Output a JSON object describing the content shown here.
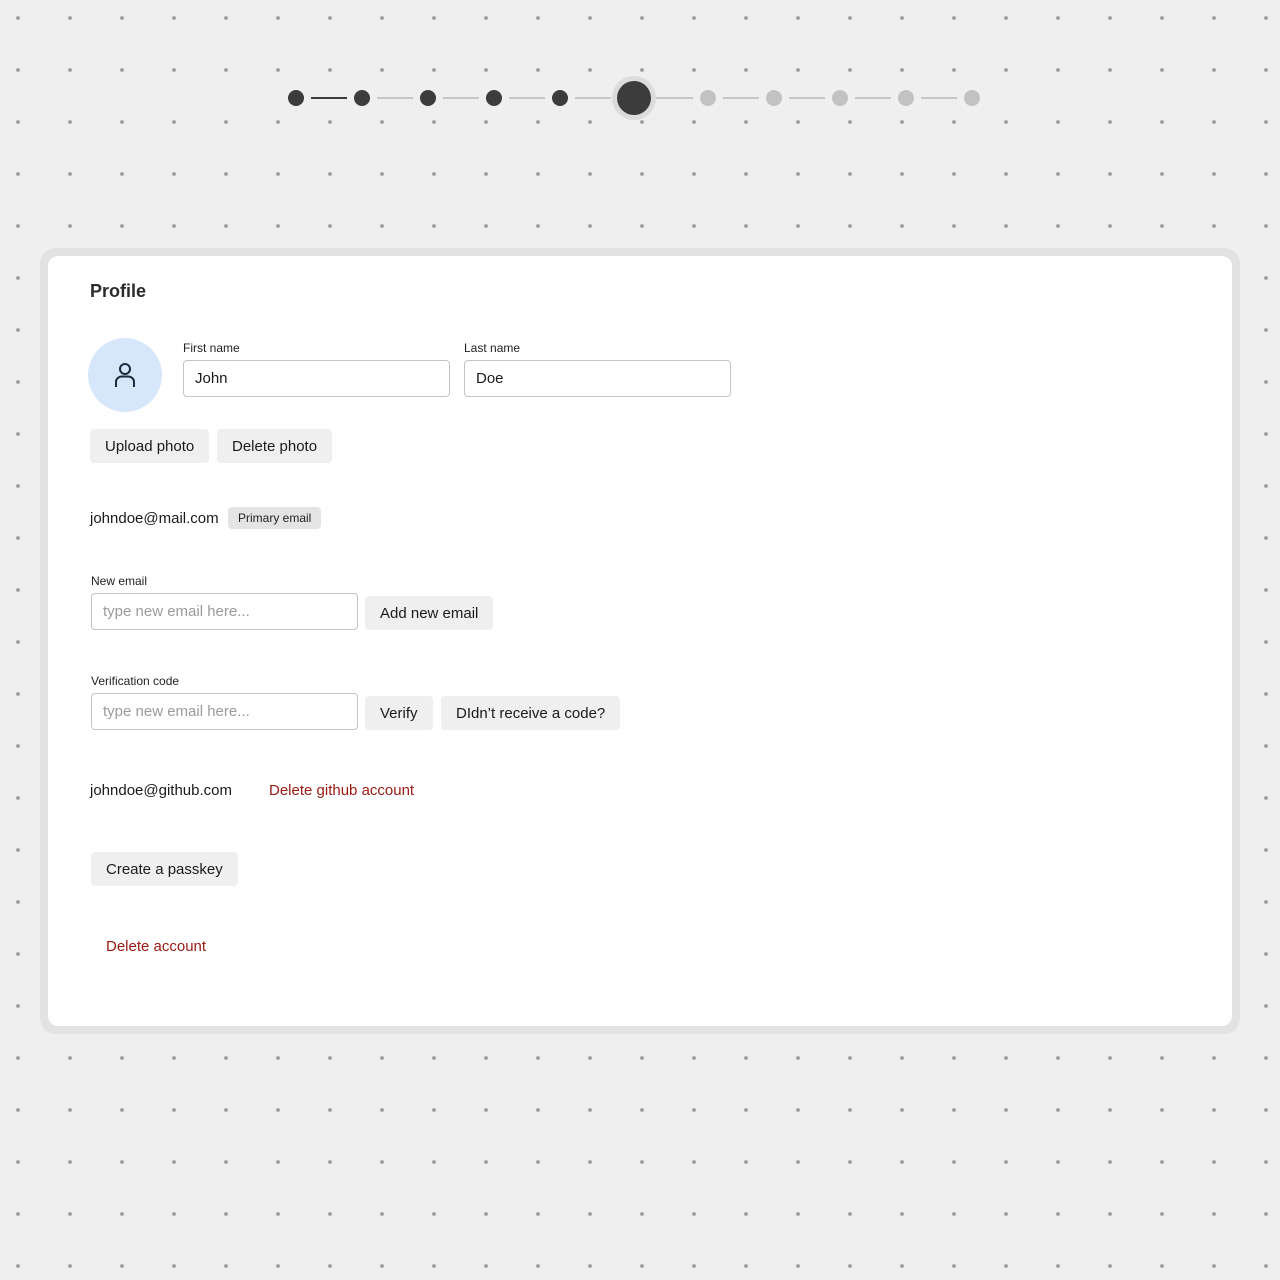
{
  "stepper": {
    "completed_steps": 5,
    "current_step": 6,
    "total_steps": 11,
    "colors": {
      "done": "#3c3c3c",
      "todo": "#c2c2c2"
    }
  },
  "profile": {
    "title": "Profile",
    "avatar_icon": "user-icon",
    "first_name_label": "First name",
    "first_name_value": "John",
    "last_name_label": "Last name",
    "last_name_value": "Doe",
    "upload_photo_label": "Upload photo",
    "delete_photo_label": "Delete photo",
    "primary_email": "johndoe@mail.com",
    "primary_badge": "Primary email",
    "new_email_label": "New email",
    "new_email_placeholder": "type new email here...",
    "add_email_label": "Add new email",
    "verification_label": "Verification code",
    "verification_placeholder": "type new email here...",
    "verify_label": "Verify",
    "resend_label": "DIdn’t receive a code?",
    "github_email": "johndoe@github.com",
    "delete_github_label": "Delete github account",
    "create_passkey_label": "Create a passkey",
    "delete_account_label": "Delete account",
    "danger_color": "#9a1a12"
  }
}
